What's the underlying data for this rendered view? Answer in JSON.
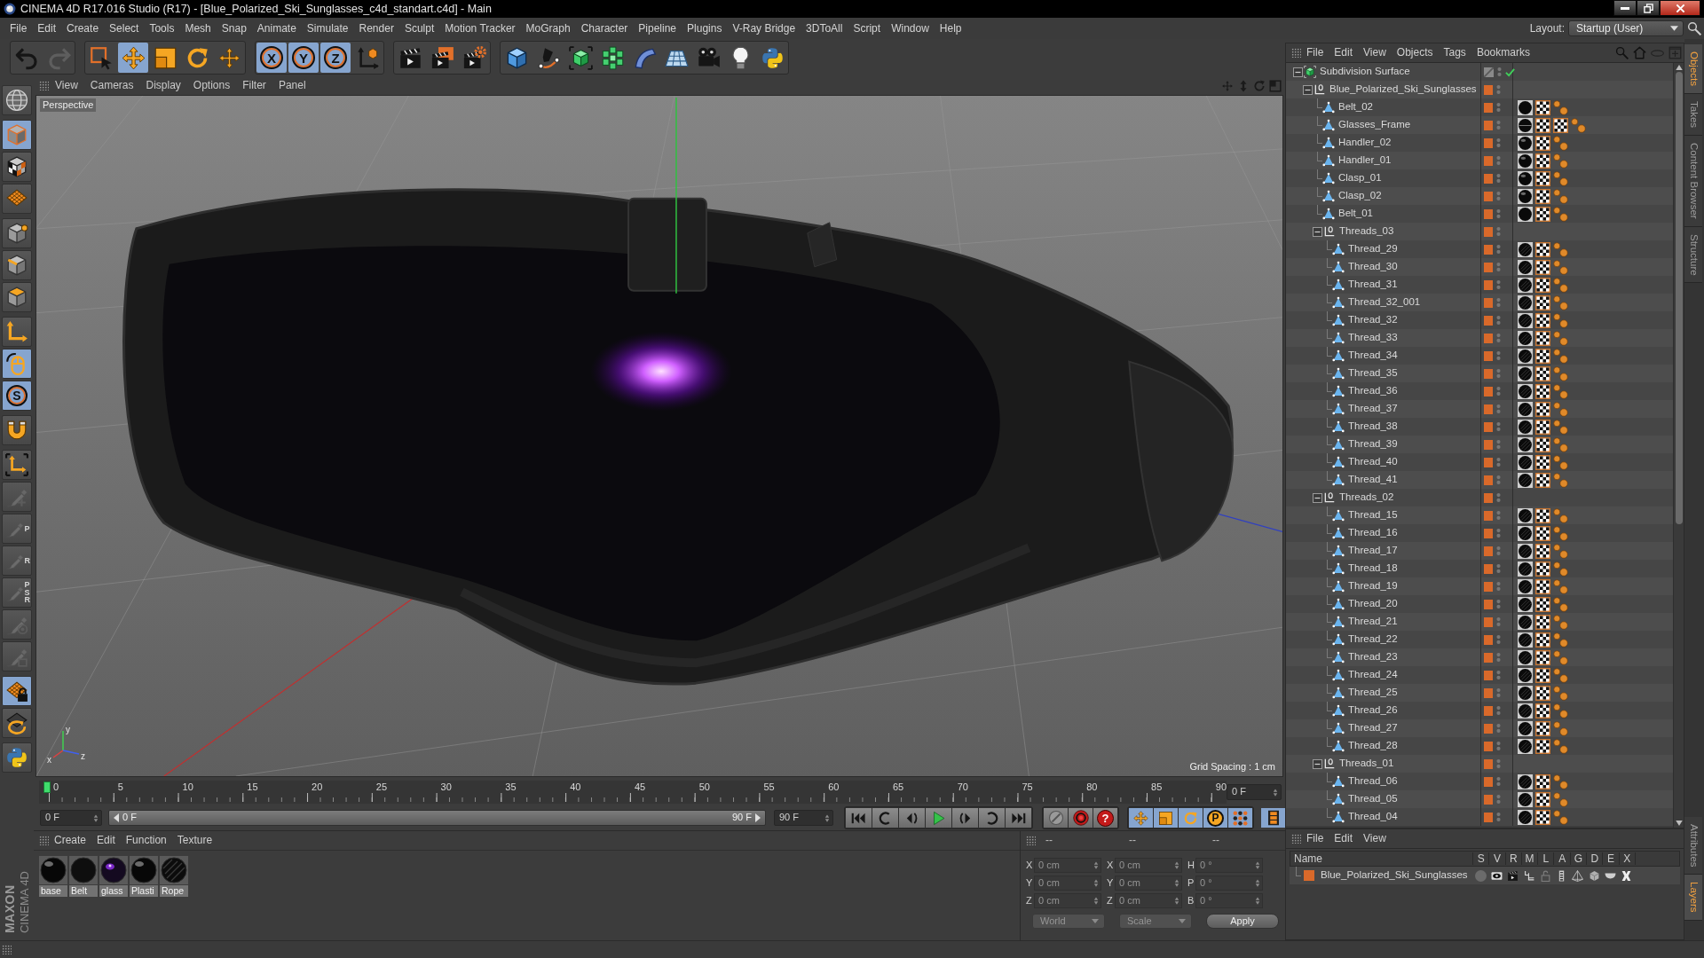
{
  "window": {
    "title": "CINEMA 4D R17.016 Studio (R17) - [Blue_Polarized_Ski_Sunglasses_c4d_standart.c4d] - Main"
  },
  "menu": [
    "File",
    "Edit",
    "Create",
    "Select",
    "Tools",
    "Mesh",
    "Snap",
    "Animate",
    "Simulate",
    "Render",
    "Sculpt",
    "Motion Tracker",
    "MoGraph",
    "Character",
    "Pipeline",
    "Plugins",
    "V-Ray Bridge",
    "3DToAll",
    "Script",
    "Window",
    "Help"
  ],
  "layout": {
    "label": "Layout:",
    "value": "Startup (User)"
  },
  "toolbar": [
    [
      {
        "kind": "undo",
        "active": false,
        "disabled": false
      },
      {
        "kind": "redo",
        "active": false,
        "disabled": true
      }
    ],
    [
      {
        "kind": "select",
        "active": false,
        "disabled": false
      },
      {
        "kind": "move",
        "active": true,
        "disabled": false
      },
      {
        "kind": "scale",
        "active": false,
        "disabled": false
      },
      {
        "kind": "rotate",
        "active": false,
        "disabled": false
      },
      {
        "kind": "recent",
        "active": false,
        "disabled": false
      }
    ],
    [
      {
        "kind": "axis",
        "label": "X",
        "active": true,
        "disabled": false
      },
      {
        "kind": "axis",
        "label": "Y",
        "active": true,
        "disabled": false
      },
      {
        "kind": "axis",
        "label": "Z",
        "active": true,
        "disabled": false
      },
      {
        "kind": "coords",
        "active": false,
        "disabled": false
      }
    ],
    [
      {
        "kind": "render_view",
        "active": false,
        "disabled": false
      },
      {
        "kind": "render_picture",
        "active": false,
        "disabled": false
      },
      {
        "kind": "render_settings",
        "active": false,
        "disabled": false
      }
    ],
    [
      {
        "kind": "cube",
        "active": false,
        "disabled": false
      },
      {
        "kind": "pen",
        "active": false,
        "disabled": false
      },
      {
        "kind": "subdivision",
        "active": false,
        "disabled": false
      },
      {
        "kind": "cloner",
        "active": false,
        "disabled": false
      },
      {
        "kind": "bend",
        "active": false,
        "disabled": false
      },
      {
        "kind": "floor",
        "active": false,
        "disabled": false
      },
      {
        "kind": "camera",
        "active": false,
        "disabled": false
      },
      {
        "kind": "light",
        "active": false,
        "disabled": false
      },
      {
        "kind": "python",
        "active": false,
        "disabled": false
      }
    ]
  ],
  "tools": [
    [
      {
        "kind": "globe",
        "active": false,
        "disabled": false
      }
    ],
    [
      {
        "kind": "model",
        "active": true,
        "disabled": false
      },
      {
        "kind": "texture",
        "active": false,
        "disabled": false
      },
      {
        "kind": "workplane_grid",
        "active": false,
        "disabled": false
      }
    ],
    [
      {
        "kind": "points",
        "active": false,
        "disabled": false
      },
      {
        "kind": "edges",
        "active": false,
        "disabled": false
      },
      {
        "kind": "polygons",
        "active": false,
        "disabled": false
      }
    ],
    [
      {
        "kind": "axis_tool",
        "active": false,
        "disabled": false
      },
      {
        "kind": "tweak",
        "active": true,
        "disabled": false
      },
      {
        "kind": "snap",
        "label": "S",
        "active": true,
        "disabled": false
      }
    ],
    [
      {
        "kind": "magnet",
        "active": false,
        "disabled": false
      }
    ],
    [
      {
        "kind": "workplane",
        "active": false,
        "disabled": false
      },
      {
        "kind": "brush_add",
        "active": false,
        "disabled": true
      },
      {
        "kind": "brush",
        "label": "P",
        "active": false,
        "disabled": true
      },
      {
        "kind": "brush",
        "label": "R",
        "active": false,
        "disabled": true
      },
      {
        "kind": "brush",
        "label": "PSR",
        "active": false,
        "disabled": true
      },
      {
        "kind": "brush_target",
        "active": false,
        "disabled": true
      },
      {
        "kind": "brush_box",
        "active": false,
        "disabled": true
      }
    ],
    [
      {
        "kind": "grid_lock",
        "active": true,
        "disabled": false
      },
      {
        "kind": "grid_rotate",
        "active": false,
        "disabled": false
      }
    ],
    [
      {
        "kind": "python",
        "active": false,
        "disabled": false
      }
    ]
  ],
  "viewport": {
    "menu": [
      "View",
      "Cameras",
      "Display",
      "Options",
      "Filter",
      "Panel"
    ],
    "camera": "Perspective",
    "grid_spacing": "Grid Spacing : 1 cm",
    "axis_labels": [
      "y",
      "x",
      "z"
    ]
  },
  "timeline": {
    "ticks": [
      "0",
      "5",
      "10",
      "15",
      "20",
      "25",
      "30",
      "35",
      "40",
      "45",
      "50",
      "55",
      "60",
      "65",
      "70",
      "75",
      "80",
      "85",
      "90"
    ],
    "playhead": {
      "level": 0
    },
    "current": "0 F"
  },
  "playback": {
    "start": "0 F",
    "range": {
      "start": "0 F",
      "end": "90 F"
    },
    "end": "90 F",
    "record": [
      {
        "kind": "key"
      },
      {
        "kind": "record"
      },
      {
        "kind": "auto",
        "label": "?"
      }
    ],
    "keys": [
      {
        "kind": "move",
        "active": true
      },
      {
        "kind": "scale",
        "active": true
      },
      {
        "kind": "rotate",
        "active": true
      },
      {
        "kind": "param",
        "label": "P",
        "active": true
      },
      {
        "kind": "pla",
        "active": true
      }
    ],
    "timeline_active": true
  },
  "materials": {
    "menu": [
      "Create",
      "Edit",
      "Function",
      "Texture"
    ],
    "items": [
      {
        "name": "base",
        "kind": "glossy"
      },
      {
        "name": "Belt",
        "kind": "matte"
      },
      {
        "name": "glass",
        "kind": "glass"
      },
      {
        "name": "Plasti",
        "kind": "glossy"
      },
      {
        "name": "Rope",
        "kind": "rope"
      }
    ]
  },
  "coordinates": {
    "headers": [
      "--",
      "--",
      "--"
    ],
    "disabled": true,
    "rows": [
      [
        {
          "label": "X",
          "value": "0 cm"
        },
        {
          "label": "X",
          "value": "0 cm"
        },
        {
          "label": "H",
          "value": "0 °"
        }
      ],
      [
        {
          "label": "Y",
          "value": "0 cm"
        },
        {
          "label": "Y",
          "value": "0 cm"
        },
        {
          "label": "P",
          "value": "0 °"
        }
      ],
      [
        {
          "label": "Z",
          "value": "0 cm"
        },
        {
          "label": "Z",
          "value": "0 cm"
        },
        {
          "label": "B",
          "value": "0 °"
        }
      ]
    ],
    "space": "World",
    "mode": "Scale",
    "apply": "Apply"
  },
  "logo": {
    "brand": "MAXON",
    "product": "CINEMA 4D"
  },
  "object_manager": {
    "menu": [
      "File",
      "Edit",
      "View",
      "Objects",
      "Tags",
      "Bookmarks"
    ],
    "tree": [
      {
        "name": "Subdivision Surface",
        "kind": "subdivision",
        "expanded": true,
        "on_layer": false,
        "enabled": true,
        "children": [
          {
            "name": "Blue_Polarized_Ski_Sunglasses",
            "kind": "null",
            "expanded": true,
            "on_layer": true,
            "children": [
              {
                "name": "Belt_02",
                "kind": "polygon",
                "on_layer": true,
                "tags": [
                  {
                    "kind": "matte"
                  },
                  {
                    "kind": "checker"
                  },
                  {
                    "kind": "balls"
                  }
                ]
              },
              {
                "name": "Glasses_Frame",
                "kind": "polygon",
                "on_layer": true,
                "tags": [
                  {
                    "kind": "banded"
                  },
                  {
                    "kind": "checker"
                  },
                  {
                    "kind": "checker"
                  },
                  {
                    "kind": "balls"
                  }
                ]
              },
              {
                "name": "Handler_02",
                "kind": "polygon",
                "on_layer": true,
                "tags": [
                  {
                    "kind": "glossy"
                  },
                  {
                    "kind": "checker"
                  },
                  {
                    "kind": "balls"
                  }
                ]
              },
              {
                "name": "Handler_01",
                "kind": "polygon",
                "on_layer": true,
                "tags": [
                  {
                    "kind": "glossy"
                  },
                  {
                    "kind": "checker"
                  },
                  {
                    "kind": "balls"
                  }
                ]
              },
              {
                "name": "Clasp_01",
                "kind": "polygon",
                "on_layer": true,
                "tags": [
                  {
                    "kind": "glossy"
                  },
                  {
                    "kind": "checker"
                  },
                  {
                    "kind": "balls"
                  }
                ]
              },
              {
                "name": "Clasp_02",
                "kind": "polygon",
                "on_layer": true,
                "tags": [
                  {
                    "kind": "glossy"
                  },
                  {
                    "kind": "checker"
                  },
                  {
                    "kind": "balls"
                  }
                ]
              },
              {
                "name": "Belt_01",
                "kind": "polygon",
                "on_layer": true,
                "tags": [
                  {
                    "kind": "matte"
                  },
                  {
                    "kind": "checker"
                  },
                  {
                    "kind": "balls"
                  }
                ]
              },
              {
                "name": "Threads_03",
                "kind": "null",
                "expanded": true,
                "on_layer": true,
                "children": [
                  {
                    "name": "Thread_29",
                    "kind": "polygon",
                    "on_layer": true,
                    "tags": [
                      {
                        "kind": "rope"
                      },
                      {
                        "kind": "checker"
                      },
                      {
                        "kind": "balls"
                      }
                    ]
                  },
                  {
                    "name": "Thread_30",
                    "kind": "polygon",
                    "on_layer": true,
                    "tags": [
                      {
                        "kind": "rope"
                      },
                      {
                        "kind": "checker"
                      },
                      {
                        "kind": "balls"
                      }
                    ]
                  },
                  {
                    "name": "Thread_31",
                    "kind": "polygon",
                    "on_layer": true,
                    "tags": [
                      {
                        "kind": "rope"
                      },
                      {
                        "kind": "checker"
                      },
                      {
                        "kind": "balls"
                      }
                    ]
                  },
                  {
                    "name": "Thread_32_001",
                    "kind": "polygon",
                    "on_layer": true,
                    "tags": [
                      {
                        "kind": "rope"
                      },
                      {
                        "kind": "checker"
                      },
                      {
                        "kind": "balls"
                      }
                    ]
                  },
                  {
                    "name": "Thread_32",
                    "kind": "polygon",
                    "on_layer": true,
                    "tags": [
                      {
                        "kind": "rope"
                      },
                      {
                        "kind": "checker"
                      },
                      {
                        "kind": "balls"
                      }
                    ]
                  },
                  {
                    "name": "Thread_33",
                    "kind": "polygon",
                    "on_layer": true,
                    "tags": [
                      {
                        "kind": "rope"
                      },
                      {
                        "kind": "checker"
                      },
                      {
                        "kind": "balls"
                      }
                    ]
                  },
                  {
                    "name": "Thread_34",
                    "kind": "polygon",
                    "on_layer": true,
                    "tags": [
                      {
                        "kind": "rope"
                      },
                      {
                        "kind": "checker"
                      },
                      {
                        "kind": "balls"
                      }
                    ]
                  },
                  {
                    "name": "Thread_35",
                    "kind": "polygon",
                    "on_layer": true,
                    "tags": [
                      {
                        "kind": "rope"
                      },
                      {
                        "kind": "checker"
                      },
                      {
                        "kind": "balls"
                      }
                    ]
                  },
                  {
                    "name": "Thread_36",
                    "kind": "polygon",
                    "on_layer": true,
                    "tags": [
                      {
                        "kind": "rope"
                      },
                      {
                        "kind": "checker"
                      },
                      {
                        "kind": "balls"
                      }
                    ]
                  },
                  {
                    "name": "Thread_37",
                    "kind": "polygon",
                    "on_layer": true,
                    "tags": [
                      {
                        "kind": "rope"
                      },
                      {
                        "kind": "checker"
                      },
                      {
                        "kind": "balls"
                      }
                    ]
                  },
                  {
                    "name": "Thread_38",
                    "kind": "polygon",
                    "on_layer": true,
                    "tags": [
                      {
                        "kind": "rope"
                      },
                      {
                        "kind": "checker"
                      },
                      {
                        "kind": "balls"
                      }
                    ]
                  },
                  {
                    "name": "Thread_39",
                    "kind": "polygon",
                    "on_layer": true,
                    "tags": [
                      {
                        "kind": "rope"
                      },
                      {
                        "kind": "checker"
                      },
                      {
                        "kind": "balls"
                      }
                    ]
                  },
                  {
                    "name": "Thread_40",
                    "kind": "polygon",
                    "on_layer": true,
                    "tags": [
                      {
                        "kind": "rope"
                      },
                      {
                        "kind": "checker"
                      },
                      {
                        "kind": "balls"
                      }
                    ]
                  },
                  {
                    "name": "Thread_41",
                    "kind": "polygon",
                    "on_layer": true,
                    "tags": [
                      {
                        "kind": "rope"
                      },
                      {
                        "kind": "checker"
                      },
                      {
                        "kind": "balls"
                      }
                    ]
                  }
                ]
              },
              {
                "name": "Threads_02",
                "kind": "null",
                "expanded": true,
                "on_layer": true,
                "children": [
                  {
                    "name": "Thread_15",
                    "kind": "polygon",
                    "on_layer": true,
                    "tags": [
                      {
                        "kind": "rope"
                      },
                      {
                        "kind": "checker"
                      },
                      {
                        "kind": "balls"
                      }
                    ]
                  },
                  {
                    "name": "Thread_16",
                    "kind": "polygon",
                    "on_layer": true,
                    "tags": [
                      {
                        "kind": "rope"
                      },
                      {
                        "kind": "checker"
                      },
                      {
                        "kind": "balls"
                      }
                    ]
                  },
                  {
                    "name": "Thread_17",
                    "kind": "polygon",
                    "on_layer": true,
                    "tags": [
                      {
                        "kind": "rope"
                      },
                      {
                        "kind": "checker"
                      },
                      {
                        "kind": "balls"
                      }
                    ]
                  },
                  {
                    "name": "Thread_18",
                    "kind": "polygon",
                    "on_layer": true,
                    "tags": [
                      {
                        "kind": "rope"
                      },
                      {
                        "kind": "checker"
                      },
                      {
                        "kind": "balls"
                      }
                    ]
                  },
                  {
                    "name": "Thread_19",
                    "kind": "polygon",
                    "on_layer": true,
                    "tags": [
                      {
                        "kind": "rope"
                      },
                      {
                        "kind": "checker"
                      },
                      {
                        "kind": "balls"
                      }
                    ]
                  },
                  {
                    "name": "Thread_20",
                    "kind": "polygon",
                    "on_layer": true,
                    "tags": [
                      {
                        "kind": "rope"
                      },
                      {
                        "kind": "checker"
                      },
                      {
                        "kind": "balls"
                      }
                    ]
                  },
                  {
                    "name": "Thread_21",
                    "kind": "polygon",
                    "on_layer": true,
                    "tags": [
                      {
                        "kind": "rope"
                      },
                      {
                        "kind": "checker"
                      },
                      {
                        "kind": "balls"
                      }
                    ]
                  },
                  {
                    "name": "Thread_22",
                    "kind": "polygon",
                    "on_layer": true,
                    "tags": [
                      {
                        "kind": "rope"
                      },
                      {
                        "kind": "checker"
                      },
                      {
                        "kind": "balls"
                      }
                    ]
                  },
                  {
                    "name": "Thread_23",
                    "kind": "polygon",
                    "on_layer": true,
                    "tags": [
                      {
                        "kind": "rope"
                      },
                      {
                        "kind": "checker"
                      },
                      {
                        "kind": "balls"
                      }
                    ]
                  },
                  {
                    "name": "Thread_24",
                    "kind": "polygon",
                    "on_layer": true,
                    "tags": [
                      {
                        "kind": "rope"
                      },
                      {
                        "kind": "checker"
                      },
                      {
                        "kind": "balls"
                      }
                    ]
                  },
                  {
                    "name": "Thread_25",
                    "kind": "polygon",
                    "on_layer": true,
                    "tags": [
                      {
                        "kind": "rope"
                      },
                      {
                        "kind": "checker"
                      },
                      {
                        "kind": "balls"
                      }
                    ]
                  },
                  {
                    "name": "Thread_26",
                    "kind": "polygon",
                    "on_layer": true,
                    "tags": [
                      {
                        "kind": "rope"
                      },
                      {
                        "kind": "checker"
                      },
                      {
                        "kind": "balls"
                      }
                    ]
                  },
                  {
                    "name": "Thread_27",
                    "kind": "polygon",
                    "on_layer": true,
                    "tags": [
                      {
                        "kind": "rope"
                      },
                      {
                        "kind": "checker"
                      },
                      {
                        "kind": "balls"
                      }
                    ]
                  },
                  {
                    "name": "Thread_28",
                    "kind": "polygon",
                    "on_layer": true,
                    "tags": [
                      {
                        "kind": "rope"
                      },
                      {
                        "kind": "checker"
                      },
                      {
                        "kind": "balls"
                      }
                    ]
                  }
                ]
              },
              {
                "name": "Threads_01",
                "kind": "null",
                "expanded": true,
                "on_layer": true,
                "children": [
                  {
                    "name": "Thread_06",
                    "kind": "polygon",
                    "on_layer": true,
                    "tags": [
                      {
                        "kind": "rope"
                      },
                      {
                        "kind": "checker"
                      },
                      {
                        "kind": "balls"
                      }
                    ]
                  },
                  {
                    "name": "Thread_05",
                    "kind": "polygon",
                    "on_layer": true,
                    "tags": [
                      {
                        "kind": "rope"
                      },
                      {
                        "kind": "checker"
                      },
                      {
                        "kind": "balls"
                      }
                    ]
                  },
                  {
                    "name": "Thread_04",
                    "kind": "polygon",
                    "on_layer": true,
                    "tags": [
                      {
                        "kind": "rope"
                      },
                      {
                        "kind": "checker"
                      },
                      {
                        "kind": "balls"
                      }
                    ]
                  }
                ]
              }
            ]
          }
        ]
      }
    ]
  },
  "layers": {
    "menu": [
      "File",
      "Edit",
      "View"
    ],
    "columns": [
      "Name",
      "S",
      "V",
      "R",
      "M",
      "L",
      "A",
      "G",
      "D",
      "E",
      "X"
    ],
    "rows": [
      {
        "name": "Blue_Polarized_Ski_Sunglasses",
        "color": "#d9692a",
        "switches": [
          {
            "on": false
          },
          {
            "on": true
          },
          {
            "on": true
          },
          {
            "on": true
          },
          {
            "on": false
          },
          {
            "on": true
          },
          {
            "on": true
          },
          {
            "on": true
          },
          {
            "on": true
          },
          {
            "on": true
          }
        ]
      }
    ]
  },
  "side_tabs": {
    "top": [
      {
        "label": "Objects",
        "selected": true
      },
      {
        "label": "Takes",
        "selected": false
      },
      {
        "label": "Content Browser",
        "selected": false
      },
      {
        "label": "Structure",
        "selected": false
      }
    ],
    "bottom": [
      {
        "label": "Attributes",
        "selected": false
      },
      {
        "label": "Layers",
        "selected": true
      }
    ]
  }
}
